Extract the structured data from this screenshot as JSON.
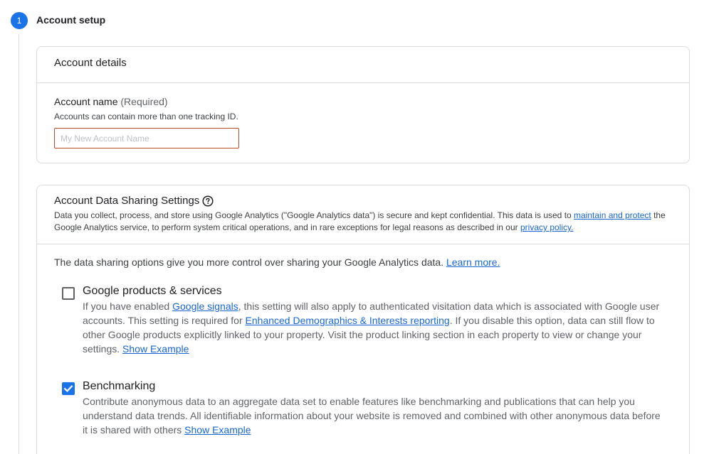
{
  "step": {
    "number": "1",
    "title": "Account setup"
  },
  "account_details": {
    "title": "Account details",
    "field_label": "Account name",
    "field_required": "(Required)",
    "field_help": "Accounts can contain more than one tracking ID.",
    "input_value": "",
    "input_placeholder": "My New Account Name"
  },
  "sharing": {
    "title": "Account Data Sharing Settings",
    "help_icon": "help-circle-icon",
    "intro_text_1": "Data you collect, process, and store using Google Analytics (\"Google Analytics data\") is secure and kept confidential. This data is used to ",
    "intro_link_1": "maintain and protect",
    "intro_text_2": " the Google Analytics service, to perform system critical operations, and in rare exceptions for legal reasons as described in our ",
    "intro_link_2": "privacy policy.",
    "options_lead": "The data sharing options give you more control over sharing your Google Analytics data. ",
    "learn_more": "Learn more.",
    "options": [
      {
        "title": "Google products & services",
        "checked": false,
        "desc_1": "If you have enabled ",
        "link_1": "Google signals",
        "desc_2": ", this setting will also apply to authenticated visitation data which is associated with Google user accounts. This setting is required for ",
        "link_2": "Enhanced Demographics & Interests reporting",
        "desc_3": ". If you disable this option, data can still flow to other Google products explicitly linked to your property. Visit the product linking section in each property to view or change your settings. ",
        "show_example": "Show Example"
      },
      {
        "title": "Benchmarking",
        "checked": true,
        "desc_1": "Contribute anonymous data to an aggregate data set to enable features like benchmarking and publications that can help you understand data trends. All identifiable information about your website is removed and combined with other anonymous data before it is shared with others ",
        "show_example": "Show Example"
      }
    ]
  },
  "colors": {
    "accent": "#1a73e8",
    "link": "#1967d2",
    "input_border": "#b94a28",
    "border": "#dadce0"
  }
}
